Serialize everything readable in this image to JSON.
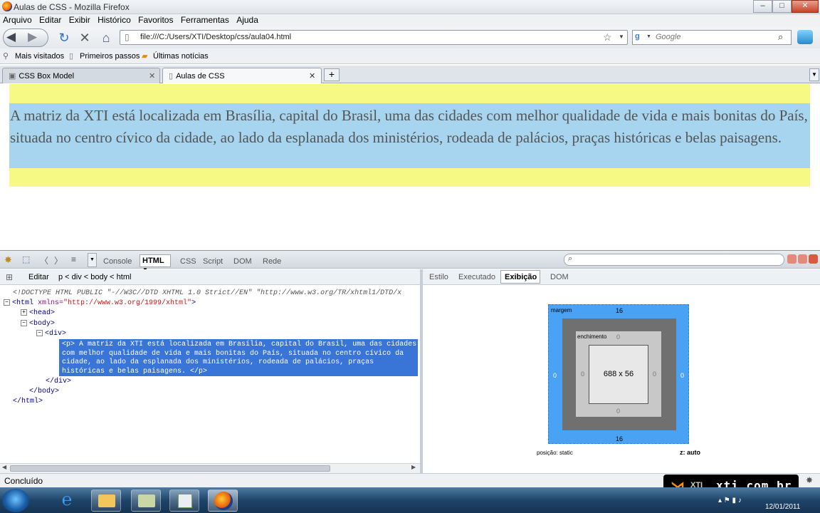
{
  "window": {
    "title": "Aulas de CSS - Mozilla Firefox"
  },
  "menu": [
    "Arquivo",
    "Editar",
    "Exibir",
    "Histórico",
    "Favoritos",
    "Ferramentas",
    "Ajuda"
  ],
  "address": {
    "url": "file:///C:/Users/XTI/Desktop/css/aula04.html"
  },
  "search": {
    "placeholder": "Google"
  },
  "bookmarks": [
    "Mais visitados",
    "Primeiros passos",
    "Últimas notícias"
  ],
  "tabs": [
    {
      "label": "CSS Box Model"
    },
    {
      "label": "Aulas de CSS",
      "active": true
    }
  ],
  "page": {
    "paragraph": "A matriz da XTI está localizada em Brasília, capital do Brasil, uma das cidades com melhor qualidade de vida e mais bonitas do País, situada no centro cívico da cidade, ao lado da esplanada dos ministérios, rodeada de palácios, praças históricas e belas paisagens.",
    "div_color": "#f6f984",
    "p_color": "#a7d4ee"
  },
  "firebug": {
    "tabs": [
      "Console",
      "HTML",
      "CSS",
      "Script",
      "DOM",
      "Rede"
    ],
    "active_tab": "HTML",
    "edit_label": "Editar",
    "breadcrumb": "p < div < body < html",
    "side_tabs": [
      "Estilo",
      "Executado",
      "Exibição",
      "DOM"
    ],
    "active_side_tab": "Exibição",
    "code": {
      "doctype": "<!DOCTYPE HTML PUBLIC \"-//W3C//DTD XHTML 1.0 Strict//EN\" \"http://www.w3.org/TR/xhtml1/DTD/x",
      "html_open": "<html",
      "html_attr": " xmlns=",
      "html_val": "\"http://www.w3.org/1999/xhtml\"",
      "html_close_bracket": ">",
      "head": "<head>",
      "body": "<body>",
      "div": "<div>",
      "p_selected": "<p> A matriz da XTI está localizada em Brasília, capital do Brasil, uma das cidades com melhor qualidade de vida e mais bonitas do País, situada no centro cívico da cidade, ao lado da esplanada dos ministérios, rodeada de palácios, praças históricas e belas paisagens. </p>",
      "div_close": "</div>",
      "body_close": "</body>",
      "html_close": "</html>"
    },
    "layout": {
      "margin_label": "margem",
      "margin_top": "16",
      "margin_bottom": "16",
      "margin_left": "0",
      "margin_right": "0",
      "padding_label": "enchimento",
      "padding_top": "0",
      "padding_bottom": "0",
      "padding_left": "0",
      "padding_right": "0",
      "content_size": "688 x 56",
      "position": "posição: static",
      "z": "z: auto"
    }
  },
  "status": {
    "text": "Concluído"
  },
  "taskbar": {
    "date": "12/01/2011"
  },
  "watermark": {
    "brand": "XTI",
    "site": "xti.com.br"
  }
}
